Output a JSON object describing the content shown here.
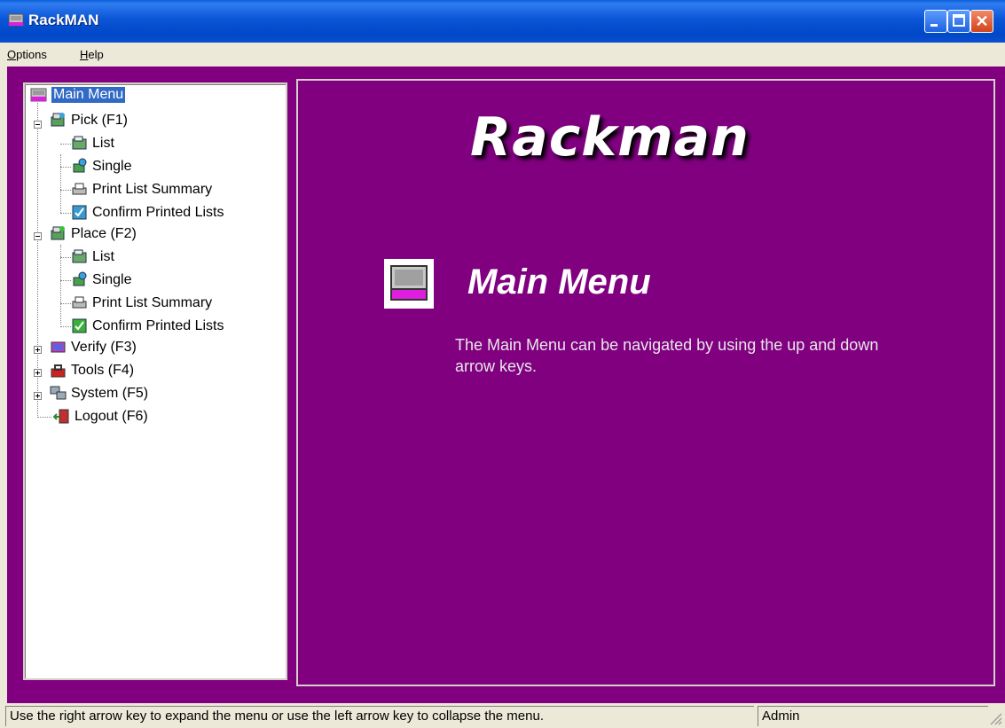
{
  "window": {
    "title": "RackMAN",
    "buttons": {
      "minimize": "minimize-icon",
      "maximize": "maximize-icon",
      "close": "close-icon"
    }
  },
  "menubar": {
    "options": "ptions",
    "options_mnemonic": "O",
    "help": "elp",
    "help_mnemonic": "H"
  },
  "tree": {
    "root": "Main Menu",
    "pick": {
      "label": "Pick (F1)",
      "children": [
        "List",
        "Single",
        "Print List Summary",
        "Confirm Printed Lists"
      ]
    },
    "place": {
      "label": "Place (F2)",
      "children": [
        "List",
        "Single",
        "Print List Summary",
        "Confirm Printed Lists"
      ]
    },
    "verify": "Verify (F3)",
    "tools": "Tools (F4)",
    "system": "System (F5)",
    "logout": "Logout (F6)"
  },
  "content": {
    "brand": "Rackman",
    "heading": "Main Menu",
    "description": "The Main Menu can be navigated by using the up and down arrow keys."
  },
  "statusbar": {
    "message": "Use the right arrow key to expand the menu or use the left arrow key to collapse the menu.",
    "user": "Admin"
  },
  "colors": {
    "frame": "#800080",
    "titlebar": "#0a55d6",
    "selection": "#316ac5",
    "chrome": "#ece9d8"
  }
}
